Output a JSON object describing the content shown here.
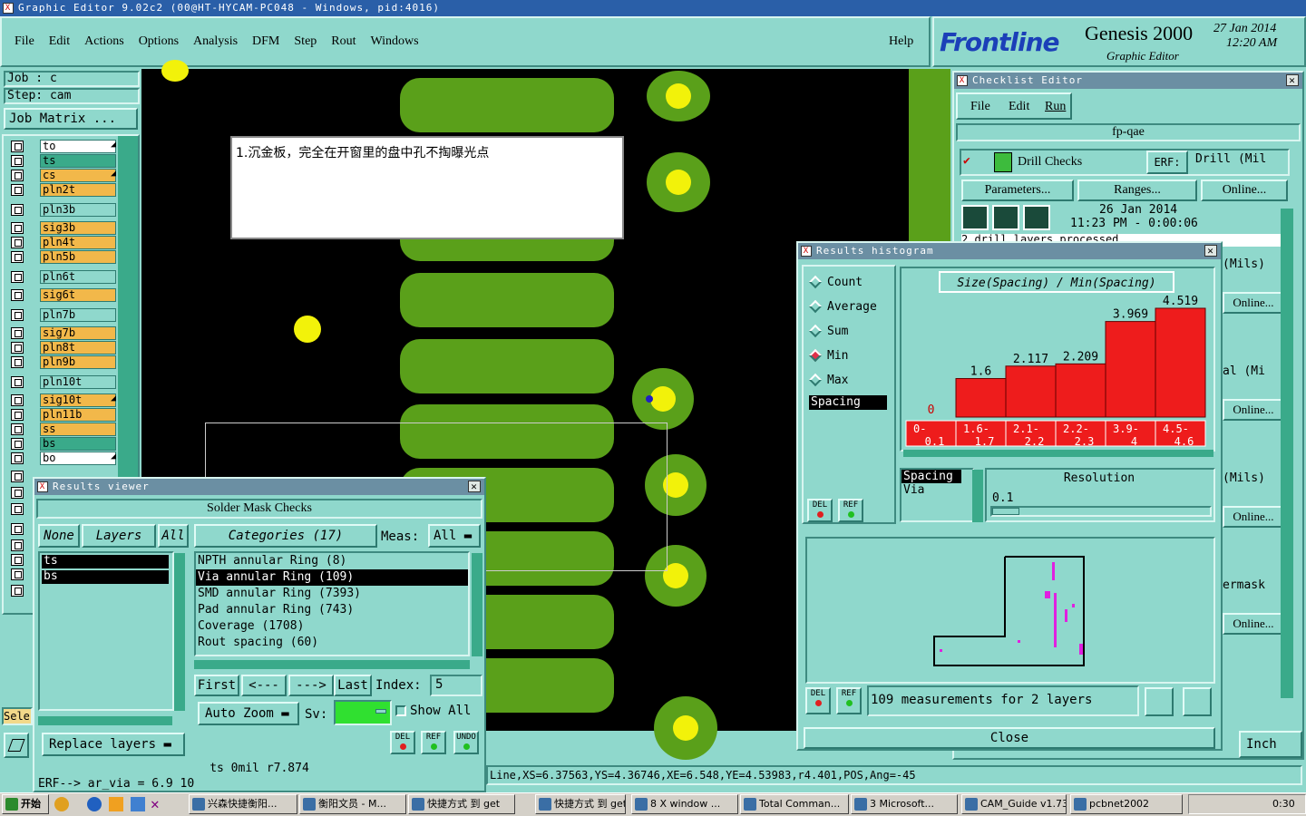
{
  "window": {
    "title": "Graphic Editor 9.02c2 (00@HT-HYCAM-PC048 - Windows, pid:4016)"
  },
  "menubar": {
    "items": [
      "File",
      "Edit",
      "Actions",
      "Options",
      "Analysis",
      "DFM",
      "Step",
      "Rout",
      "Windows"
    ],
    "help": "Help"
  },
  "brand": {
    "logo": "Frontline",
    "product": "Genesis 2000",
    "subtitle": "Graphic Editor",
    "date": "27 Jan 2014",
    "time": "12:20 AM"
  },
  "job": {
    "job_label": "Job : c",
    "step_label": "Step: cam",
    "matrix_button": "Job Matrix ..."
  },
  "layers": [
    {
      "name": "to",
      "color": "wh",
      "arrow": true
    },
    {
      "name": "ts",
      "color": "gr"
    },
    {
      "name": "cs",
      "color": "or",
      "arrow": true
    },
    {
      "name": "pln2t",
      "color": "or"
    },
    {
      "name": "pln3b",
      "color": "tl"
    },
    {
      "name": "sig3b",
      "color": "or"
    },
    {
      "name": "pln4t",
      "color": "or"
    },
    {
      "name": "pln5b",
      "color": "or"
    },
    {
      "name": "pln6t",
      "color": "tl"
    },
    {
      "name": "sig6t",
      "color": "or"
    },
    {
      "name": "pln7b",
      "color": "tl"
    },
    {
      "name": "sig7b",
      "color": "or"
    },
    {
      "name": "pln8t",
      "color": "or"
    },
    {
      "name": "pln9b",
      "color": "or"
    },
    {
      "name": "pln10t",
      "color": "tl"
    },
    {
      "name": "sig10t",
      "color": "or",
      "arrow": true
    },
    {
      "name": "pln11b",
      "color": "or"
    },
    {
      "name": "ss",
      "color": "or"
    },
    {
      "name": "bs",
      "color": "gr"
    },
    {
      "name": "bo",
      "color": "wh",
      "arrow": true
    }
  ],
  "annotation": {
    "text": "1.沉金板，完全在开窗里的盘中孔不掏曝光点"
  },
  "checklist": {
    "title": "Checklist Editor",
    "menu": [
      "File",
      "Edit",
      "Run"
    ],
    "name": "fp-qae",
    "check_name": "Drill Checks",
    "erf_label": "ERF:",
    "erf_value": "Drill (Mil",
    "parameters": "Parameters...",
    "ranges": "Ranges...",
    "online": "Online...",
    "run_date": "26 Jan 2014",
    "run_time": "11:23 PM - 0:00:06",
    "status": "2 drill layers processed",
    "right_items": [
      "(Mils)",
      "Online...",
      "al (Mi",
      "Online...",
      "(Mils)",
      "Online...",
      "ermask",
      "Online..."
    ]
  },
  "histogram": {
    "title": "Results histogram",
    "modes": [
      "Count",
      "Average",
      "Sum",
      "Min",
      "Max"
    ],
    "selected_mode": "Min",
    "list_item": "Spacing",
    "chart_title": "Size(Spacing) / Min(Spacing)",
    "del": "DEL",
    "ref": "REF",
    "sel_items": [
      "Spacing",
      "Via"
    ],
    "resolution_label": "Resolution",
    "resolution_value": "0.1",
    "summary": "109 measurements for 2 layers",
    "close": "Close"
  },
  "chart_data": {
    "type": "bar",
    "title": "Size(Spacing) / Min(Spacing)",
    "categories": [
      "0-0.1",
      "1.6-1.7",
      "2.1-2.2",
      "2.2-2.3",
      "3.9-4",
      "4.5-4.6"
    ],
    "cat_top": [
      "0-",
      "1.6-",
      "2.1-",
      "2.2-",
      "3.9-",
      "4.5-"
    ],
    "cat_bot": [
      "0.1",
      "1.7",
      "2.2",
      "2.3",
      "4",
      "4.6"
    ],
    "values": [
      0,
      1.6,
      2.117,
      2.209,
      3.969,
      4.519
    ],
    "value_labels": [
      "0",
      "1.6",
      "2.117",
      "2.209",
      "3.969",
      "4.519"
    ],
    "ylim": [
      0,
      4.519
    ],
    "bar_color": "#ee1c1c"
  },
  "results": {
    "title": "Results viewer",
    "header": "Solder Mask Checks",
    "none": "None",
    "layers": "Layers",
    "all": "All",
    "categories": "Categories (17)",
    "meas_label": "Meas:",
    "meas_value": "All",
    "layer_list": [
      "ts",
      "bs"
    ],
    "category_list": [
      "NPTH annular Ring (8)",
      "Via annular Ring (109)",
      "SMD annular Ring (7393)",
      "Pad annular Ring (743)",
      "Coverage (1708)",
      "Rout spacing (60)"
    ],
    "selected_category": 1,
    "first": "First",
    "prev": "<---",
    "next": "--->",
    "last": "Last",
    "index_label": "Index:",
    "index_value": "5",
    "auto_zoom": "Auto Zoom",
    "sv_label": "Sv:",
    "show_all": "Show All",
    "replace_layers": "Replace layers",
    "del": "DEL",
    "ref": "REF",
    "undo": "UNDO",
    "layer_info": "ts 0mil  r7.874",
    "erf_line": "ERF--> ar_via = 6.9 10"
  },
  "statusbar": {
    "coords": "Line,XS=6.37563,YS=4.36746,XE=6.548,YE=4.53983,r4.401,POS,Ang=-45",
    "units": "Inch",
    "sel": "Sele"
  },
  "taskbar": {
    "start": "开始",
    "items": [
      "兴森快捷衡阳...",
      "衡阳文员 - M...",
      "快捷方式 到 get",
      "快捷方式 到 get",
      "8 X window ...",
      "Total Comman...",
      "3 Microsoft...",
      "CAM_Guide v1.73",
      "pcbnet2002"
    ],
    "clock": "0:30"
  }
}
